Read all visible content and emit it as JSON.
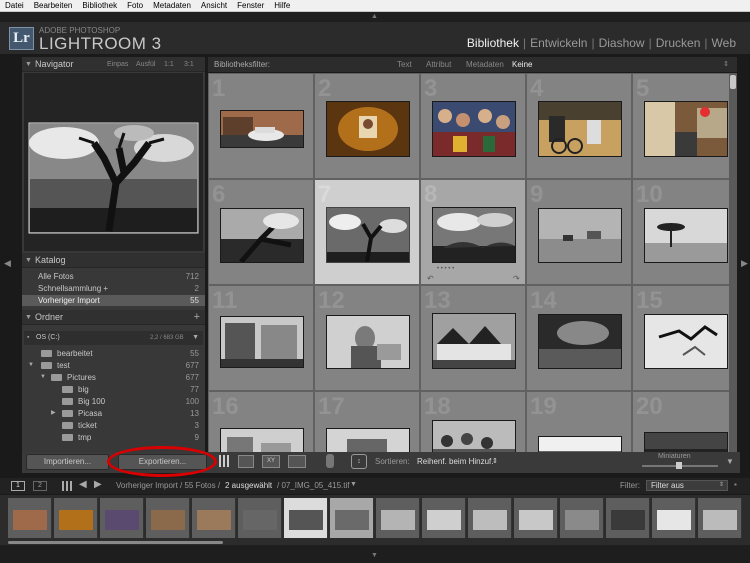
{
  "menu": [
    "Datei",
    "Bearbeiten",
    "Bibliothek",
    "Foto",
    "Metadaten",
    "Ansicht",
    "Fenster",
    "Hilfe"
  ],
  "app": {
    "logo_text": "Lr",
    "adobe_label": "ADOBE PHOTOSHOP",
    "product_name": "LIGHTROOM 3"
  },
  "modules": [
    {
      "label": "Bibliothek",
      "active": true
    },
    {
      "label": "Entwickeln"
    },
    {
      "label": "Diashow"
    },
    {
      "label": "Drucken"
    },
    {
      "label": "Web"
    }
  ],
  "navigator": {
    "title": "Navigator",
    "zoom_options": [
      "Einpas",
      "Ausfül",
      "1:1",
      "3:1"
    ]
  },
  "catalog": {
    "title": "Katalog",
    "items": [
      {
        "label": "Alle Fotos",
        "count": "712"
      },
      {
        "label": "Schnellsammlung +",
        "count": "2"
      },
      {
        "label": "Vorheriger Import",
        "count": "55",
        "selected": true
      }
    ]
  },
  "folders": {
    "title": "Ordner",
    "add_icon": "plus-icon",
    "volume": {
      "label": "OS (C:)",
      "space": "2,2 / 683 GB"
    },
    "items": [
      {
        "label": "bearbeitet",
        "count": "55"
      },
      {
        "label": "test",
        "count": "677"
      },
      {
        "label": "Pictures",
        "count": "677"
      },
      {
        "label": "big",
        "count": "77"
      },
      {
        "label": "Big 100",
        "count": "100"
      },
      {
        "label": "Picasa",
        "count": "13"
      },
      {
        "label": "ticket",
        "count": "3"
      },
      {
        "label": "tmp",
        "count": "9"
      }
    ]
  },
  "buttons": {
    "import": "Importieren...",
    "export": "Exportieren..."
  },
  "filter_bar": {
    "label": "Bibliotheksfilter:",
    "options": [
      "Text",
      "Attribut",
      "Metadaten",
      "Keine"
    ],
    "active": "Keine"
  },
  "toolbar": {
    "sort_label": "Sortieren:",
    "sort_value": "Reihenf. beim Hinzuf.",
    "thumbnails_label": "Miniaturen"
  },
  "filmstrip_header": {
    "pages": [
      "1",
      "2"
    ],
    "breadcrumb_prefix": "Vorheriger Import / 55 Fotos /",
    "breadcrumb_selected": "2 ausgewählt",
    "breadcrumb_file": "/ 07_IMG_05_415.tif",
    "filter_label": "Filter:",
    "filter_value": "Filter aus"
  },
  "grid_numbers": [
    "1",
    "2",
    "3",
    "4",
    "5",
    "6",
    "7",
    "8",
    "9",
    "10",
    "11",
    "12",
    "13",
    "14",
    "15",
    "16",
    "17",
    "18",
    "19",
    "20"
  ],
  "colors": {
    "accent_red": "#d80000",
    "selected_cell": "#cfcfcf",
    "grid_bg": "#707070"
  }
}
